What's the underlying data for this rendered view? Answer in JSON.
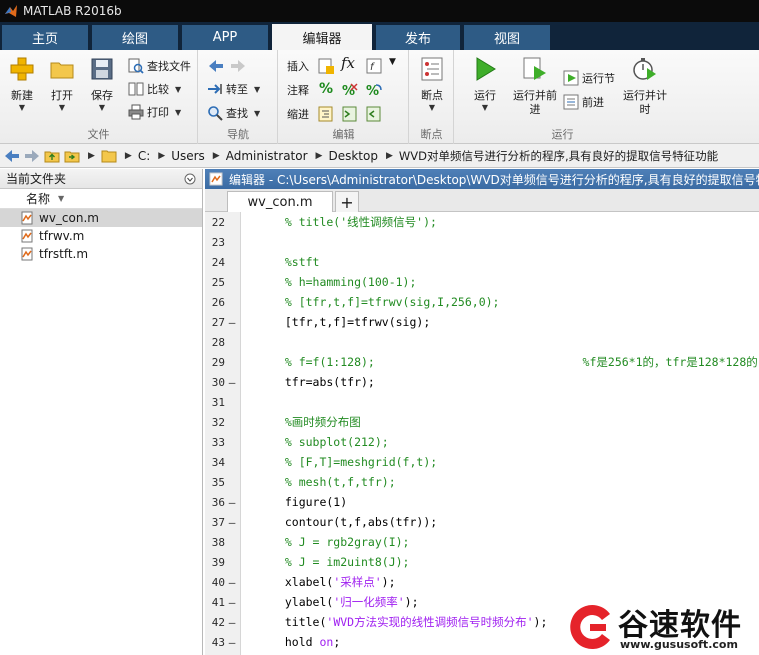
{
  "window": {
    "title": "MATLAB R2016b"
  },
  "tabs": [
    {
      "label": "主页",
      "active": false
    },
    {
      "label": "绘图",
      "active": false
    },
    {
      "label": "APP",
      "active": false
    },
    {
      "label": "编辑器",
      "active": true
    },
    {
      "label": "发布",
      "active": false
    },
    {
      "label": "视图",
      "active": false
    }
  ],
  "toolstrip": {
    "file": {
      "title": "文件",
      "new": "新建",
      "open": "打开",
      "save": "保存",
      "find_files": "查找文件",
      "compare": "比较",
      "print": "打印"
    },
    "navigate": {
      "title": "导航",
      "goto": "转至",
      "find": "查找"
    },
    "edit": {
      "title": "编辑",
      "insert": "插入",
      "comment": "注释",
      "indent": "缩进",
      "fx": "fx"
    },
    "breakpoints": {
      "title": "断点",
      "breakpoints": "断点"
    },
    "run": {
      "title": "运行",
      "run": "运行",
      "run_advance": "运行并前进",
      "run_section": "运行节",
      "advance": "前进",
      "run_time": "运行并计时"
    }
  },
  "address": {
    "crumbs": [
      "C:",
      "Users",
      "Administrator",
      "Desktop",
      "WVD对单频信号进行分析的程序,具有良好的提取信号特征功能"
    ]
  },
  "current_folder": {
    "title": "当前文件夹",
    "column": "名称",
    "files": [
      {
        "name": "wv_con.m",
        "selected": true
      },
      {
        "name": "tfrwv.m",
        "selected": false
      },
      {
        "name": "tfrstft.m",
        "selected": false
      }
    ]
  },
  "editor": {
    "title": "编辑器 - C:\\Users\\Administrator\\Desktop\\WVD对单频信号进行分析的程序,具有良好的提取信号特征功能",
    "tab": "wv_con.m",
    "new_tab": "+",
    "lines": [
      {
        "n": "22",
        "bp": "",
        "parts": [
          {
            "t": "  % title('线性调频信号');",
            "c": "cmt"
          }
        ]
      },
      {
        "n": "23",
        "bp": "",
        "parts": []
      },
      {
        "n": "24",
        "bp": "",
        "parts": [
          {
            "t": "  %stft",
            "c": "cmt"
          }
        ]
      },
      {
        "n": "25",
        "bp": "",
        "parts": [
          {
            "t": "  % h=hamming(100-1);",
            "c": "cmt"
          }
        ]
      },
      {
        "n": "26",
        "bp": "",
        "parts": [
          {
            "t": "  % [tfr,t,f]=tfrwv(sig,I,256,0);",
            "c": "cmt"
          }
        ]
      },
      {
        "n": "27",
        "bp": "—",
        "parts": [
          {
            "t": "  [tfr,t,f]=tfrwv(sig);",
            "c": "plain"
          }
        ]
      },
      {
        "n": "28",
        "bp": "",
        "parts": []
      },
      {
        "n": "29",
        "bp": "",
        "parts": [
          {
            "t": "  % f=f(1:128);                              %f是256*1的，tfr是128*128的，",
            "c": "cmt"
          }
        ]
      },
      {
        "n": "30",
        "bp": "—",
        "parts": [
          {
            "t": "  tfr=abs(tfr);",
            "c": "plain"
          }
        ]
      },
      {
        "n": "31",
        "bp": "",
        "parts": []
      },
      {
        "n": "32",
        "bp": "",
        "parts": [
          {
            "t": "  %画时频分布图",
            "c": "cmt"
          }
        ]
      },
      {
        "n": "33",
        "bp": "",
        "parts": [
          {
            "t": "  % subplot(212);",
            "c": "cmt"
          }
        ]
      },
      {
        "n": "34",
        "bp": "",
        "parts": [
          {
            "t": "  % [F,T]=meshgrid(f,t);",
            "c": "cmt"
          }
        ]
      },
      {
        "n": "35",
        "bp": "",
        "parts": [
          {
            "t": "  % mesh(t,f,tfr);",
            "c": "cmt"
          }
        ]
      },
      {
        "n": "36",
        "bp": "—",
        "parts": [
          {
            "t": "  figure(1)",
            "c": "plain"
          }
        ]
      },
      {
        "n": "37",
        "bp": "—",
        "parts": [
          {
            "t": "  contour(t,f,abs(tfr));",
            "c": "plain"
          }
        ]
      },
      {
        "n": "38",
        "bp": "",
        "parts": [
          {
            "t": "  % J = rgb2gray(I);",
            "c": "cmt"
          }
        ]
      },
      {
        "n": "39",
        "bp": "",
        "parts": [
          {
            "t": "  % J = im2uint8(J);",
            "c": "cmt"
          }
        ]
      },
      {
        "n": "40",
        "bp": "—",
        "parts": [
          {
            "t": "  xlabel(",
            "c": "plain"
          },
          {
            "t": "'采样点'",
            "c": "str"
          },
          {
            "t": ");",
            "c": "plain"
          }
        ]
      },
      {
        "n": "41",
        "bp": "—",
        "parts": [
          {
            "t": "  ylabel(",
            "c": "plain"
          },
          {
            "t": "'归一化频率'",
            "c": "str"
          },
          {
            "t": ");",
            "c": "plain"
          }
        ]
      },
      {
        "n": "42",
        "bp": "—",
        "parts": [
          {
            "t": "  title(",
            "c": "plain"
          },
          {
            "t": "'WVD方法实现的线性调频信号时频分布'",
            "c": "str"
          },
          {
            "t": ");",
            "c": "plain"
          }
        ]
      },
      {
        "n": "43",
        "bp": "—",
        "parts": [
          {
            "t": "  hold ",
            "c": "plain"
          },
          {
            "t": "on",
            "c": "str"
          },
          {
            "t": ";",
            "c": "plain"
          }
        ]
      }
    ]
  },
  "watermark": {
    "name": "谷速软件",
    "url": "www.gususoft.com"
  },
  "colors": {
    "tab_bg": "#2e5b85",
    "tab_strip": "#10243a",
    "editor_title": "#3b6ba3",
    "comment": "#228b22",
    "string": "#a020f0"
  }
}
